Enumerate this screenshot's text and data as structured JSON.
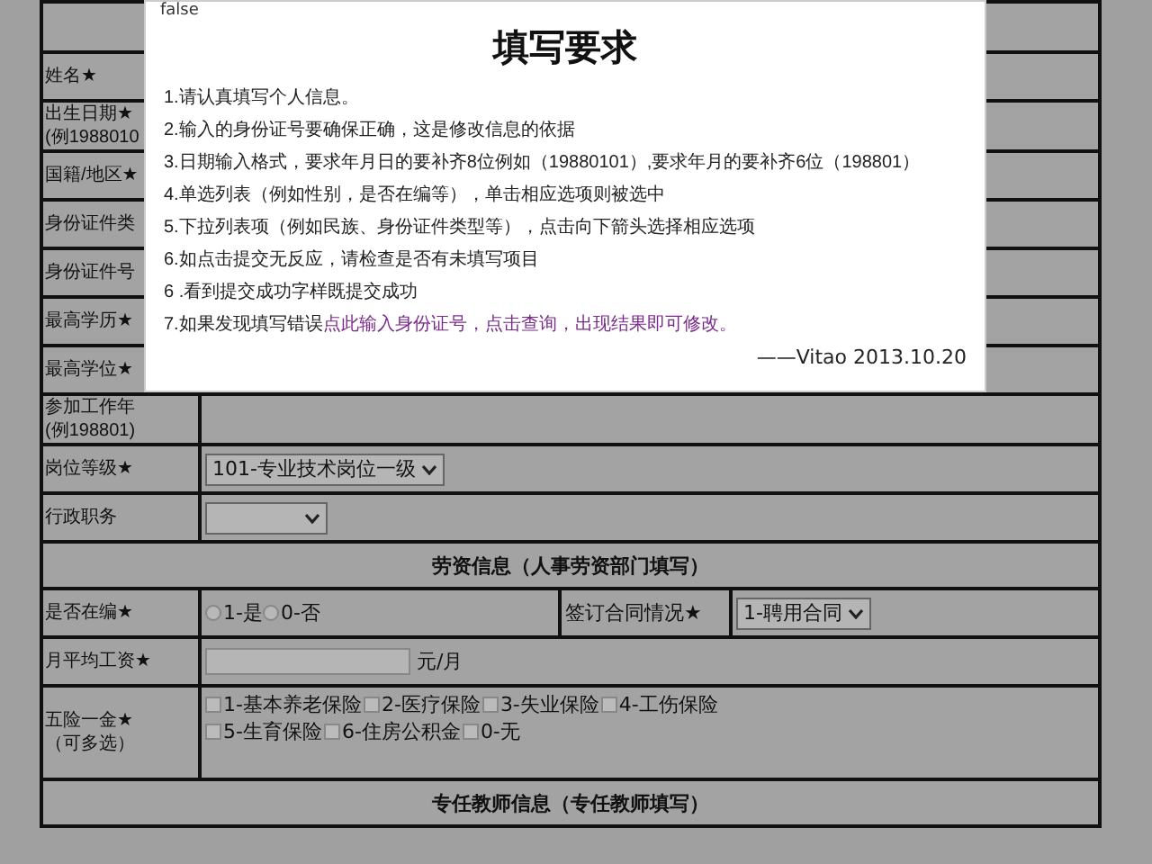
{
  "form": {
    "rows": [
      {
        "kind": "blank"
      },
      {
        "kind": "field",
        "label_lines": [
          "姓名★"
        ]
      },
      {
        "kind": "field",
        "label_lines": [
          "出生日期★",
          "(例1988010"
        ]
      },
      {
        "kind": "field",
        "label_lines": [
          "国籍/地区★"
        ]
      },
      {
        "kind": "field",
        "label_lines": [
          "身份证件类"
        ]
      },
      {
        "kind": "field",
        "label_lines": [
          "身份证件号"
        ]
      },
      {
        "kind": "field",
        "label_lines": [
          "最高学历★"
        ]
      },
      {
        "kind": "field",
        "label_lines": [
          "最高学位★"
        ]
      },
      {
        "kind": "field",
        "label_lines": [
          "参加工作年",
          "(例198801)"
        ]
      },
      {
        "kind": "select",
        "label_lines": [
          "岗位等级★"
        ],
        "value": "101-专业技术岗位一级"
      },
      {
        "kind": "select",
        "label_lines": [
          "行政职务"
        ]
      },
      {
        "kind": "section",
        "title": "劳资信息（人事劳资部门填写）"
      },
      {
        "kind": "radio_pair",
        "label_lines": [
          "是否在编★"
        ],
        "options": [
          {
            "label": "1-是",
            "selected": false
          },
          {
            "label": "0-否",
            "selected": false
          }
        ],
        "second_label": "签订合同情况★",
        "second_value": "1-聘用合同"
      },
      {
        "kind": "amount",
        "label_lines": [
          "月平均工资★"
        ],
        "unit": "元/月"
      },
      {
        "kind": "checks",
        "label_lines": [
          "五险一金★",
          "（可多选）"
        ],
        "option_rows": [
          [
            {
              "label": "1-基本养老保险",
              "checked": false
            },
            {
              "label": "2-医疗保险",
              "checked": false
            },
            {
              "label": "3-失业保险",
              "checked": false
            },
            {
              "label": "4-工伤保险",
              "checked": false
            }
          ],
          [
            {
              "label": "5-生育保险",
              "checked": false
            },
            {
              "label": "6-住房公积金",
              "checked": false
            },
            {
              "label": "0-无",
              "checked": false
            }
          ]
        ]
      },
      {
        "kind": "section",
        "title": "专任教师信息（专任教师填写）"
      }
    ]
  },
  "modal": {
    "status_text": "false",
    "title": "填写要求",
    "rules": [
      {
        "text": "1.请认真填写个人信息。"
      },
      {
        "text": "2.输入的身份证号要确保正确，这是修改信息的依据"
      },
      {
        "text": "3.日期输入格式，要求年月日的要补齐8位例如（19880101）,要求年月的要补齐6位（198801）"
      },
      {
        "text": "4.单选列表（例如性别，是否在编等），单击相应选项则被选中"
      },
      {
        "text": "5.下拉列表项（例如民族、身份证件类型等），点击向下箭头选择相应选项"
      },
      {
        "text": "6.如点击提交无反应，请检查是否有未填写项目"
      },
      {
        "text": "6 .看到提交成功字样既提交成功"
      },
      {
        "text": "7.如果发现填写错误",
        "link": "点此输入身份证号，点击查询，出现结果即可修改。"
      }
    ],
    "signature": "——Vitao 2013.10.20"
  }
}
